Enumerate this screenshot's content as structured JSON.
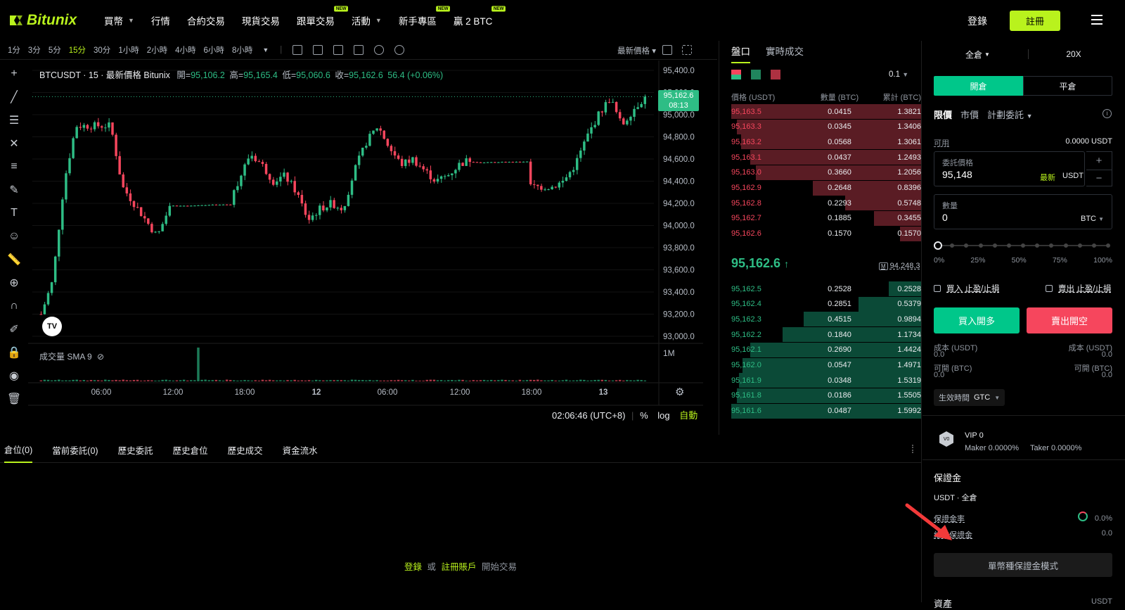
{
  "brand": {
    "name": "Bitunix",
    "accent": "#b9f21d",
    "up": "#2ebd85",
    "down": "#f6465d"
  },
  "nav": {
    "items": [
      {
        "label": "買幣",
        "caret": true
      },
      {
        "label": "行情"
      },
      {
        "label": "合約交易"
      },
      {
        "label": "現貨交易"
      },
      {
        "label": "跟單交易",
        "badge": "NEW"
      },
      {
        "label": "活動",
        "caret": true
      },
      {
        "label": "新手專區",
        "badge": "NEW"
      },
      {
        "label": "贏 2 BTC",
        "badge": "NEW"
      }
    ],
    "login": "登錄",
    "register": "註冊"
  },
  "toolbar": {
    "timeframes": [
      "1分",
      "3分",
      "5分",
      "15分",
      "30分",
      "1小時",
      "2小時",
      "4小時",
      "6小時",
      "8小時"
    ],
    "active_timeframe": "15分",
    "price_type": "最新價格"
  },
  "chart": {
    "legend_symbol": "BTCUSDT · 15 · 最新價格 Bitunix",
    "o_label": "開=",
    "o": "95,106.2",
    "h_label": "高=",
    "h": "95,165.4",
    "l_label": "低=",
    "l": "95,060.6",
    "c_label": "收=",
    "c": "95,162.6",
    "change": "56.4 (+0.06%)",
    "last_price_tag": "95,162.6",
    "countdown": "08:13",
    "volume_label": "成交量 SMA 9",
    "volume_axis": "1M",
    "time": "02:06:46 (UTC+8)",
    "pct": "%",
    "log": "log",
    "auto": "自動"
  },
  "chart_data": {
    "type": "candlestick",
    "y_ticks": [
      "95,400.0",
      "95,200.0",
      "95,000.0",
      "94,800.0",
      "94,600.0",
      "94,400.0",
      "94,200.0",
      "94,000.0",
      "93,800.0",
      "93,600.0",
      "93,400.0",
      "93,200.0",
      "93,000.0"
    ],
    "y_range": [
      93000,
      95400
    ],
    "x_ticks": [
      "06:00",
      "12:00",
      "18:00",
      "12",
      "06:00",
      "12:00",
      "18:00",
      "13"
    ],
    "close_path": [
      93200,
      93500,
      94400,
      94900,
      94900,
      94900,
      94900,
      94350,
      94200,
      94050,
      93900,
      94150,
      94300,
      94250,
      94200,
      94100,
      94250,
      94400,
      94650,
      94550,
      94400,
      94450,
      94300,
      94050,
      94150,
      94200,
      94150,
      94500,
      94750,
      94900,
      94700,
      94550,
      94600,
      94500,
      94400,
      94450,
      94550,
      94600,
      94550,
      94450,
      94350,
      94350,
      94350,
      94350,
      94350,
      94400,
      94550,
      94800,
      95000,
      95150,
      94900,
      95050,
      95160
    ]
  },
  "orderbook": {
    "tabs": [
      "盤口",
      "實時成交"
    ],
    "precision": "0.1",
    "col_price": "價格 (USDT)",
    "col_qty": "數量 (BTC)",
    "col_total": "累計 (BTC)",
    "asks": [
      {
        "p": "95,163.5",
        "q": "0.0415",
        "t": "1.3821",
        "d": 1.0
      },
      {
        "p": "95,163.3",
        "q": "0.0345",
        "t": "1.3406",
        "d": 0.97
      },
      {
        "p": "95,163.2",
        "q": "0.0568",
        "t": "1.3061",
        "d": 0.95
      },
      {
        "p": "95,163.1",
        "q": "0.0437",
        "t": "1.2493",
        "d": 0.9
      },
      {
        "p": "95,163.0",
        "q": "0.3660",
        "t": "1.2056",
        "d": 0.87
      },
      {
        "p": "95,162.9",
        "q": "0.2648",
        "t": "0.8396",
        "d": 0.57
      },
      {
        "p": "95,162.8",
        "q": "0.2293",
        "t": "0.5748",
        "d": 0.4
      },
      {
        "p": "95,162.7",
        "q": "0.1885",
        "t": "0.3455",
        "d": 0.25
      },
      {
        "p": "95,162.6",
        "q": "0.1570",
        "t": "0.1570",
        "d": 0.11
      }
    ],
    "last": "95,162.6",
    "arrow": "↑",
    "mark": "94,248.3",
    "bids": [
      {
        "p": "95,162.5",
        "q": "0.2528",
        "t": "0.2528",
        "d": 0.17
      },
      {
        "p": "95,162.4",
        "q": "0.2851",
        "t": "0.5379",
        "d": 0.33
      },
      {
        "p": "95,162.3",
        "q": "0.4515",
        "t": "0.9894",
        "d": 0.62
      },
      {
        "p": "95,162.2",
        "q": "0.1840",
        "t": "1.1734",
        "d": 0.73
      },
      {
        "p": "95,162.1",
        "q": "0.2690",
        "t": "1.4424",
        "d": 0.9
      },
      {
        "p": "95,162.0",
        "q": "0.0547",
        "t": "1.4971",
        "d": 0.94
      },
      {
        "p": "95,161.9",
        "q": "0.0348",
        "t": "1.5319",
        "d": 0.96
      },
      {
        "p": "95,161.8",
        "q": "0.0186",
        "t": "1.5505",
        "d": 0.97
      },
      {
        "p": "95,161.6",
        "q": "0.0487",
        "t": "1.5992",
        "d": 1.0
      }
    ]
  },
  "order_form": {
    "margin_mode": "全倉",
    "leverage": "20X",
    "open_tab": "開倉",
    "close_tab": "平倉",
    "type_limit": "限價",
    "type_market": "市價",
    "type_plan": "計劃委託",
    "available_label": "可用",
    "available_value": "0.0000 USDT",
    "price_label": "委託價格",
    "price_value": "95,148",
    "latest": "最新",
    "price_unit": "USDT",
    "qty_label": "數量",
    "qty_value": "0",
    "qty_unit": "BTC",
    "slider_pct": 0,
    "slider_marks": [
      "0%",
      "25%",
      "50%",
      "75%",
      "100%"
    ],
    "buy_tpsl": "買入 止盈/止損",
    "sell_tpsl": "賣出 止盈/止損",
    "buy_btn": "買入開多",
    "sell_btn": "賣出開空",
    "cost_label": "成本 (USDT)",
    "cost_value": "0.0",
    "openable_label": "可開 (BTC)",
    "openable_value": "0.0",
    "tif_label": "生效時間",
    "tif_value": "GTC"
  },
  "vip": {
    "level": "VIP 0",
    "maker": "Maker 0.0000%",
    "taker": "Taker 0.0000%"
  },
  "margin": {
    "title": "保證金",
    "account": "USDT · 全倉",
    "ratio_label": "保證金率",
    "ratio_value": "0.0%",
    "maint_label": "維持保證金",
    "maint_value": "0.0",
    "mode_btn": "單幣種保證金模式",
    "assets_label": "資產",
    "assets_unit": "USDT"
  },
  "bottom": {
    "tabs": [
      "倉位(0)",
      "當前委託(0)",
      "歷史委託",
      "歷史倉位",
      "歷史成交",
      "資金流水"
    ],
    "login": "登錄",
    "or": "或",
    "register": "註冊賬戶",
    "start": "開始交易"
  }
}
